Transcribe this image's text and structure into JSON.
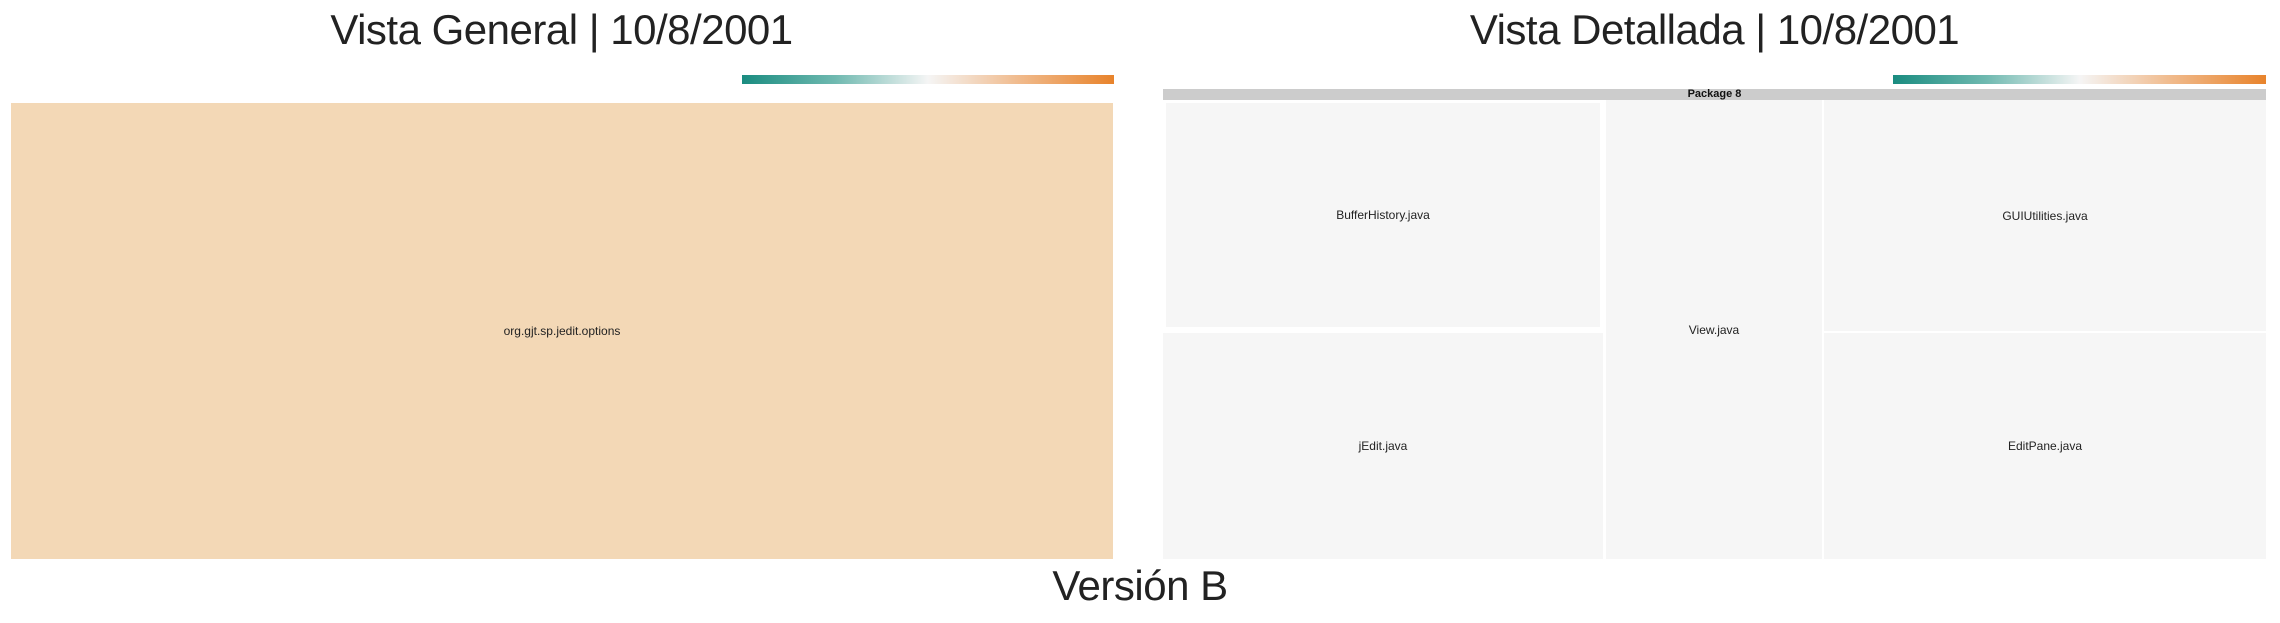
{
  "chart_data": [
    {
      "type": "treemap",
      "title": "Vista General | 10/8/2001",
      "legend": {
        "placement": "top-right",
        "colors": [
          "#1a8c80",
          "#f5f5f5",
          "#e8832b"
        ]
      },
      "nodes": [
        {
          "label": "org.gjt.sp.jedit.options",
          "color": "#f3d8b6"
        }
      ]
    },
    {
      "type": "treemap",
      "title": "Vista Detallada | 10/8/2001",
      "legend": {
        "placement": "top-right",
        "colors": [
          "#1a8c80",
          "#f5f5f5",
          "#e8832b"
        ]
      },
      "package": "Package 8",
      "nodes": [
        {
          "label": "BufferHistory.java",
          "color": "#f6f6f6"
        },
        {
          "label": "jEdit.java",
          "color": "#f6f6f6"
        },
        {
          "label": "View.java",
          "color": "#f6f6f6"
        },
        {
          "label": "GUIUtilities.java",
          "color": "#f6f6f6"
        },
        {
          "label": "EditPane.java",
          "color": "#f6f6f6"
        }
      ]
    }
  ],
  "footer": "Versión B"
}
